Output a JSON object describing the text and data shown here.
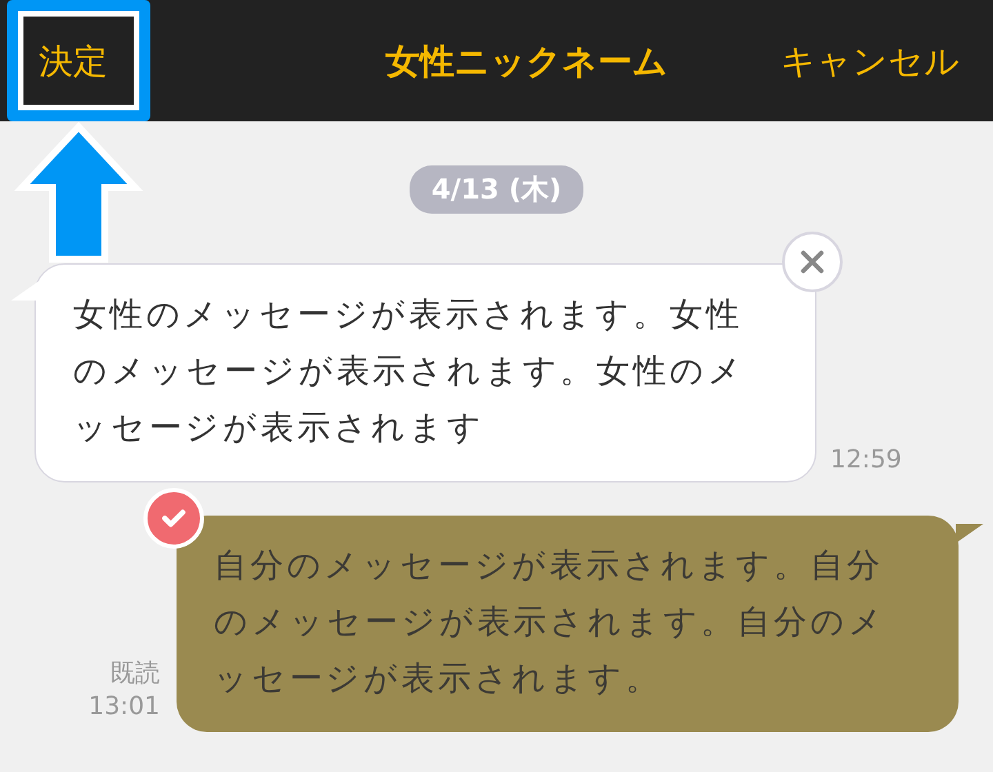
{
  "header": {
    "confirm": "決定",
    "title": "女性ニックネーム",
    "cancel": "キャンセル"
  },
  "date": "4/13 (木)",
  "messages": [
    {
      "kind": "received",
      "text": "女性のメッセージが表示されます。女性のメッセージが表示されます。女性のメッセージが表示されます",
      "time": "12:59",
      "selected": false
    },
    {
      "kind": "sent",
      "text": "自分のメッセージが表示されます。自分のメッセージが表示されます。自分のメッセージが表示されます。",
      "read": "既読",
      "time": "13:01",
      "selected": true
    }
  ]
}
